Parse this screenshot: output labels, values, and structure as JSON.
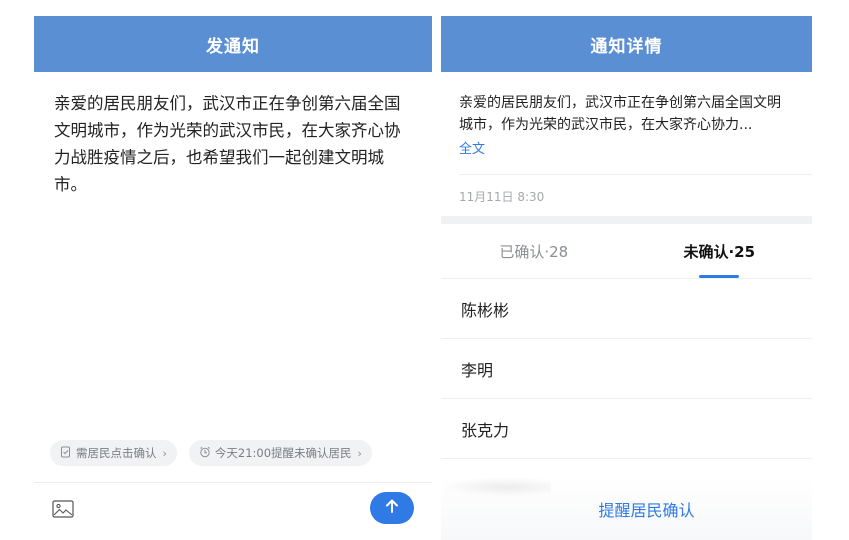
{
  "compose": {
    "title": "发通知",
    "body": "亲爱的居民朋友们，武汉市正在争创第六届全国文明城市，作为光荣的武汉市民，在大家齐心协力战胜疫情之后，也希望我们一起创建文明城市。",
    "chips": [
      {
        "label": "需居民点击确认",
        "icon": "checklist-icon"
      },
      {
        "label": "今天21:00提醒未确认居民",
        "icon": "alarm-clock-icon"
      }
    ],
    "send_icon": "arrow-up-icon",
    "image_icon": "image-icon"
  },
  "detail": {
    "title": "通知详情",
    "body": "亲爱的居民朋友们，武汉市正在争创第六届全国文明城市，作为光荣的武汉市民，在大家齐心协力...",
    "full_link": "全文",
    "timestamp": "11月11日 8:30",
    "tabs": [
      {
        "label": "已确认·28",
        "active": false
      },
      {
        "label": "未确认·25",
        "active": true
      }
    ],
    "unconfirmed": [
      "陈彬彬",
      "李明",
      "张克力"
    ],
    "remind_button": "提醒居民确认"
  },
  "colors": {
    "header": "#5b8fd4",
    "accent": "#2f7ae5"
  }
}
